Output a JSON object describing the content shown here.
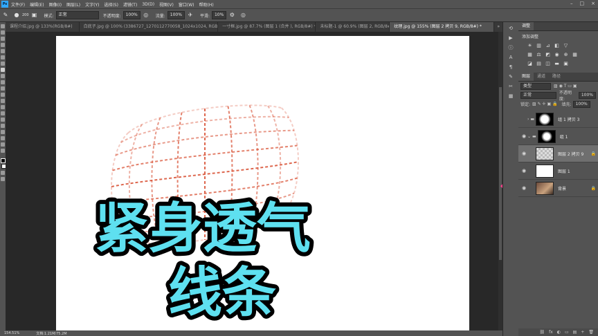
{
  "menubar": {
    "logo": "Ps",
    "items": [
      "文件(F)",
      "编辑(E)",
      "图像(I)",
      "图层(L)",
      "文字(Y)",
      "选择(S)",
      "滤镜(T)",
      "3D(D)",
      "视图(V)",
      "窗口(W)",
      "帮助(H)"
    ]
  },
  "window_controls": [
    "–",
    "□",
    "×"
  ],
  "options": {
    "brush_size": "200",
    "mode_label": "模式:",
    "mode_value": "正常",
    "opacity_label": "不透明度:",
    "opacity_value": "100%",
    "flow_label": "流量:",
    "flow_value": "100%",
    "smooth_label": "平滑:",
    "smooth_value": "10%"
  },
  "tabs": [
    "课程介绍.jpg @ 133%(RGB/8#)",
    "白底子.jpg @ 100% (3386727_1270112770058_1024x1024, RGB/8) *",
    "一寸框.jpg @ 87.7% (图层 1 (合并 ), RGB/8#) *",
    "未标题-1 @ 60.9% (图层 2, RGB/8#) *",
    "纹理.jpg @ 155% (图层 2 拷贝 9, RGB/8#) *"
  ],
  "tab_more": "»",
  "canvas": {
    "title_line1": "紧身透气",
    "title_line2": "线条",
    "text_fill": "#5ee0f0",
    "text_stroke": "#000000",
    "grid_color": "#d9553a"
  },
  "status": {
    "zoom": "154.51%",
    "doc": "文档:1.21M/75.2M"
  },
  "right_panel": {
    "adjust_tab": "调整",
    "adjust_title": "添加调整",
    "layers_tabs": [
      "图层",
      "通道",
      "路径"
    ],
    "kind_label": "类型",
    "blend": "正常",
    "opacity_label": "不透明度:",
    "opacity": "100%",
    "lock_label": "锁定:",
    "fill_label": "填充:",
    "fill": "100%",
    "layers": [
      {
        "name": "组 1 拷贝 3",
        "selected": false,
        "visible": false
      },
      {
        "name": "组 1",
        "selected": false,
        "visible": true
      },
      {
        "name": "图层 2 拷贝 9",
        "selected": true,
        "visible": true
      },
      {
        "name": "图层 1",
        "selected": false,
        "visible": true
      },
      {
        "name": "背景",
        "selected": false,
        "visible": true
      }
    ],
    "footer_icons": [
      "fx",
      "◐",
      "▭",
      "▤",
      "+",
      "🗑"
    ]
  }
}
